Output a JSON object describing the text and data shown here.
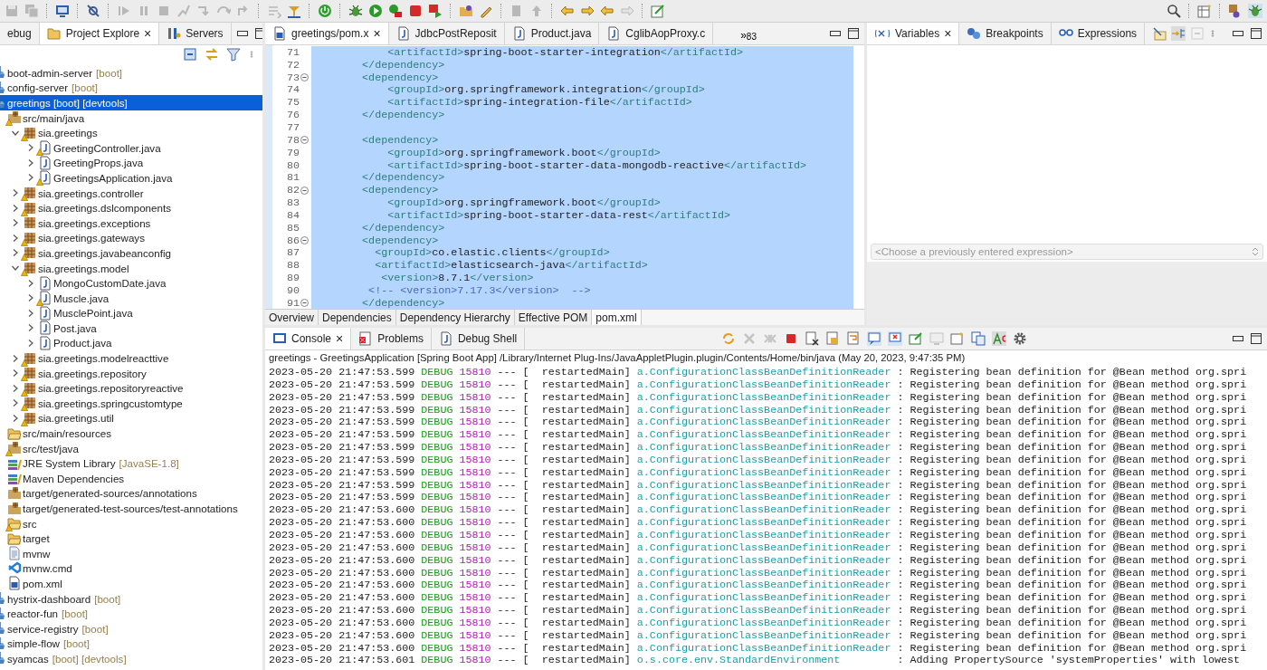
{
  "explorer": {
    "tabs": [
      {
        "label": "ebug",
        "selected": false
      },
      {
        "label": "Project Explore",
        "selected": true,
        "close": "×"
      },
      {
        "label": "Servers",
        "selected": false
      }
    ],
    "tree": [
      {
        "label": "boot-admin-server",
        "tag": "[boot]",
        "kind": "project",
        "selected": false
      },
      {
        "label": "config-server",
        "tag": "[boot]",
        "kind": "project",
        "selected": false
      },
      {
        "label": "greetings [boot] [devtools]",
        "kind": "project",
        "selected": true,
        "children": [
          {
            "label": "src/main/java",
            "kind": "source",
            "selected": false,
            "warning": true,
            "children": [
              {
                "label": "sia.greetings",
                "kind": "package",
                "selected": false,
                "warning": true,
                "expanded": true,
                "children": [
                  {
                    "label": "GreetingController.java",
                    "kind": "java",
                    "selected": false,
                    "warning": true,
                    "expanded": false
                  },
                  {
                    "label": "GreetingProps.java",
                    "kind": "java",
                    "selected": false,
                    "expanded": false
                  },
                  {
                    "label": "GreetingsApplication.java",
                    "kind": "java",
                    "selected": false,
                    "warning": true,
                    "expanded": false
                  }
                ]
              },
              {
                "label": "sia.greetings.controller",
                "kind": "package",
                "selected": false,
                "warning": true,
                "expanded": false
              },
              {
                "label": "sia.greetings.dslcomponents",
                "kind": "package",
                "selected": false,
                "warning": true,
                "expanded": false
              },
              {
                "label": "sia.greetings.exceptions",
                "kind": "package",
                "selected": false,
                "expanded": false
              },
              {
                "label": "sia.greetings.gateways",
                "kind": "package",
                "selected": false,
                "warning": true,
                "expanded": false
              },
              {
                "label": "sia.greetings.javabeanconfig",
                "kind": "package",
                "selected": false,
                "warning": true,
                "expanded": false
              },
              {
                "label": "sia.greetings.model",
                "kind": "package",
                "selected": false,
                "warning": true,
                "expanded": true,
                "children": [
                  {
                    "label": "MongoCustomDate.java",
                    "kind": "java",
                    "selected": false,
                    "expanded": false
                  },
                  {
                    "label": "Muscle.java",
                    "kind": "java",
                    "selected": false,
                    "warning": true,
                    "expanded": false
                  },
                  {
                    "label": "MusclePoint.java",
                    "kind": "java",
                    "selected": false,
                    "expanded": false
                  },
                  {
                    "label": "Post.java",
                    "kind": "java",
                    "selected": false,
                    "expanded": false
                  },
                  {
                    "label": "Product.java",
                    "kind": "java",
                    "selected": false,
                    "expanded": false
                  }
                ]
              },
              {
                "label": "sia.greetings.modelreacttive",
                "kind": "package",
                "selected": false,
                "warning": true,
                "expanded": false
              },
              {
                "label": "sia.greetings.repository",
                "kind": "package",
                "selected": false,
                "warning": true,
                "expanded": false
              },
              {
                "label": "sia.greetings.repositoryreactive",
                "kind": "package",
                "selected": false,
                "warning": true,
                "expanded": false
              },
              {
                "label": "sia.greetings.springcustomtype",
                "kind": "package",
                "selected": false,
                "warning": true,
                "expanded": false
              },
              {
                "label": "sia.greetings.util",
                "kind": "package",
                "selected": false,
                "warning": true,
                "expanded": false
              }
            ]
          },
          {
            "label": "src/main/resources",
            "kind": "folder",
            "selected": false
          },
          {
            "label": "src/test/java",
            "kind": "source",
            "selected": false,
            "warning": true
          },
          {
            "label": "JRE System Library",
            "tag": "[JavaSE-1.8]",
            "kind": "library",
            "selected": false
          },
          {
            "label": "Maven Dependencies",
            "kind": "library",
            "selected": false
          },
          {
            "label": "target/generated-sources/annotations",
            "kind": "source",
            "selected": false
          },
          {
            "label": "target/generated-test-sources/test-annotations",
            "kind": "source",
            "selected": false
          },
          {
            "label": "src",
            "kind": "folder",
            "selected": false,
            "warning": true
          },
          {
            "label": "target",
            "kind": "folder",
            "selected": false
          },
          {
            "label": "mvnw",
            "kind": "text",
            "selected": false
          },
          {
            "label": "mvnw.cmd",
            "kind": "script",
            "selected": false
          },
          {
            "label": "pom.xml",
            "kind": "maven",
            "selected": false
          }
        ]
      },
      {
        "label": "hystrix-dashboard",
        "tag": "[boot]",
        "kind": "project",
        "selected": false
      },
      {
        "label": "reactor-fun",
        "tag": "[boot]",
        "kind": "project",
        "selected": false
      },
      {
        "label": "service-registry",
        "tag": "[boot]",
        "kind": "project",
        "selected": false
      },
      {
        "label": "simple-flow",
        "tag": "[boot]",
        "kind": "project",
        "selected": false
      },
      {
        "label": "syamcas",
        "tag": "[boot] [devtools]",
        "kind": "project",
        "selected": false
      }
    ]
  },
  "editor": {
    "tabs": [
      {
        "label": "greetings/pom.x",
        "kind": "maven",
        "selected": true,
        "close": "×"
      },
      {
        "label": "JdbcPostReposit",
        "kind": "java",
        "selected": false
      },
      {
        "label": "Product.java",
        "kind": "java",
        "selected": false
      },
      {
        "label": "CglibAopProxy.c",
        "kind": "class",
        "selected": false
      }
    ],
    "overflow": {
      "chevron": "»",
      "count": "83"
    },
    "lines": [
      {
        "num": "71",
        "kind": "xml",
        "selected": true,
        "code": "            <artifactId>spring-boot-starter-integration</artifactId>"
      },
      {
        "num": "72",
        "kind": "xml",
        "selected": true,
        "code": "        </dependency>"
      },
      {
        "num": "73",
        "fold": true,
        "kind": "xml",
        "selected": true,
        "code": "        <dependency>"
      },
      {
        "num": "74",
        "kind": "xml",
        "selected": true,
        "code": "            <groupId>org.springframework.integration</groupId>"
      },
      {
        "num": "75",
        "kind": "xml",
        "selected": true,
        "code": "            <artifactId>spring-integration-file</artifactId>"
      },
      {
        "num": "76",
        "kind": "xml",
        "selected": true,
        "code": "        </dependency>"
      },
      {
        "num": "77",
        "selected": true
      },
      {
        "num": "78",
        "fold": true,
        "kind": "xml",
        "selected": true,
        "code": "        <dependency>"
      },
      {
        "num": "79",
        "kind": "xml",
        "selected": true,
        "code": "            <groupId>org.springframework.boot</groupId>"
      },
      {
        "num": "80",
        "kind": "xml",
        "selected": true,
        "code": "            <artifactId>spring-boot-starter-data-mongodb-reactive</artifactId>"
      },
      {
        "num": "81",
        "kind": "xml",
        "selected": true,
        "code": "        </dependency>"
      },
      {
        "num": "82",
        "fold": true,
        "kind": "xml",
        "selected": true,
        "code": "        <dependency>"
      },
      {
        "num": "83",
        "kind": "xml",
        "selected": true,
        "code": "            <groupId>org.springframework.boot</groupId>"
      },
      {
        "num": "84",
        "kind": "xml",
        "selected": true,
        "code": "            <artifactId>spring-boot-starter-data-rest</artifactId>"
      },
      {
        "num": "85",
        "kind": "xml",
        "selected": true,
        "code": "        </dependency>"
      },
      {
        "num": "86",
        "fold": true,
        "kind": "xml",
        "selected": true,
        "code": "        <dependency>"
      },
      {
        "num": "87",
        "kind": "xml",
        "selected": true,
        "code": "          <groupId>co.elastic.clients</groupId>"
      },
      {
        "num": "88",
        "kind": "xml",
        "selected": true,
        "code": "          <artifactId>elasticsearch-java</artifactId>"
      },
      {
        "num": "89",
        "kind": "xml",
        "selected": true,
        "code": "           <version>8.7.1</version>"
      },
      {
        "num": "90",
        "kind": "comment",
        "selected": true,
        "code": "         <!-- <version>7.17.3</version>  -->"
      },
      {
        "num": "91",
        "fold": true,
        "kind": "xml",
        "selected": true,
        "code": "        </dependency>"
      }
    ],
    "bottom_tabs": [
      {
        "label": "Overview",
        "selected": false
      },
      {
        "label": "Dependencies",
        "selected": false
      },
      {
        "label": "Dependency Hierarchy",
        "selected": false
      },
      {
        "label": "Effective POM",
        "selected": false
      },
      {
        "label": "pom.xml",
        "selected": true
      }
    ]
  },
  "variables": {
    "tabs": [
      {
        "label": "Variables",
        "kind": "variables",
        "selected": true,
        "close": "×"
      },
      {
        "label": "Breakpoints",
        "kind": "breakpoints",
        "selected": false
      },
      {
        "label": "Expressions",
        "kind": "expressions",
        "selected": false
      }
    ],
    "expression_field": {
      "placeholder": "<Choose a previously entered expression>",
      "disabled": true
    }
  },
  "console": {
    "tabs": [
      {
        "label": "Console",
        "kind": "console",
        "selected": true,
        "close": "×"
      },
      {
        "label": "Problems",
        "kind": "problems",
        "selected": false
      },
      {
        "label": "Debug Shell",
        "kind": "shell",
        "selected": false
      }
    ],
    "description": "greetings - GreetingsApplication [Spring Boot App] /Library/Internet Plug-Ins/JavaAppletPlugin.plugin/Contents/Home/bin/java  (May 20, 2023, 9:47:35 PM)",
    "lines": [
      {
        "ts": "2023-05-20 21:47:53.599",
        "level": "DEBUG",
        "pid": "15810",
        "sep": "---",
        "thread": "[  restartedMain]",
        "logger": "a.ConfigurationClassBeanDefinitionReader",
        "msg": ": Registering bean definition for @Bean method org.spri"
      },
      {
        "ts": "2023-05-20 21:47:53.599",
        "level": "DEBUG",
        "pid": "15810",
        "sep": "---",
        "thread": "[  restartedMain]",
        "logger": "a.ConfigurationClassBeanDefinitionReader",
        "msg": ": Registering bean definition for @Bean method org.spri"
      },
      {
        "ts": "2023-05-20 21:47:53.599",
        "level": "DEBUG",
        "pid": "15810",
        "sep": "---",
        "thread": "[  restartedMain]",
        "logger": "a.ConfigurationClassBeanDefinitionReader",
        "msg": ": Registering bean definition for @Bean method org.spri"
      },
      {
        "ts": "2023-05-20 21:47:53.599",
        "level": "DEBUG",
        "pid": "15810",
        "sep": "---",
        "thread": "[  restartedMain]",
        "logger": "a.ConfigurationClassBeanDefinitionReader",
        "msg": ": Registering bean definition for @Bean method org.spri"
      },
      {
        "ts": "2023-05-20 21:47:53.599",
        "level": "DEBUG",
        "pid": "15810",
        "sep": "---",
        "thread": "[  restartedMain]",
        "logger": "a.ConfigurationClassBeanDefinitionReader",
        "msg": ": Registering bean definition for @Bean method org.spri"
      },
      {
        "ts": "2023-05-20 21:47:53.599",
        "level": "DEBUG",
        "pid": "15810",
        "sep": "---",
        "thread": "[  restartedMain]",
        "logger": "a.ConfigurationClassBeanDefinitionReader",
        "msg": ": Registering bean definition for @Bean method org.spri"
      },
      {
        "ts": "2023-05-20 21:47:53.599",
        "level": "DEBUG",
        "pid": "15810",
        "sep": "---",
        "thread": "[  restartedMain]",
        "logger": "a.ConfigurationClassBeanDefinitionReader",
        "msg": ": Registering bean definition for @Bean method org.spri"
      },
      {
        "ts": "2023-05-20 21:47:53.599",
        "level": "DEBUG",
        "pid": "15810",
        "sep": "---",
        "thread": "[  restartedMain]",
        "logger": "a.ConfigurationClassBeanDefinitionReader",
        "msg": ": Registering bean definition for @Bean method org.spri"
      },
      {
        "ts": "2023-05-20 21:47:53.599",
        "level": "DEBUG",
        "pid": "15810",
        "sep": "---",
        "thread": "[  restartedMain]",
        "logger": "a.ConfigurationClassBeanDefinitionReader",
        "msg": ": Registering bean definition for @Bean method org.spri"
      },
      {
        "ts": "2023-05-20 21:47:53.599",
        "level": "DEBUG",
        "pid": "15810",
        "sep": "---",
        "thread": "[  restartedMain]",
        "logger": "a.ConfigurationClassBeanDefinitionReader",
        "msg": ": Registering bean definition for @Bean method org.spri"
      },
      {
        "ts": "2023-05-20 21:47:53.599",
        "level": "DEBUG",
        "pid": "15810",
        "sep": "---",
        "thread": "[  restartedMain]",
        "logger": "a.ConfigurationClassBeanDefinitionReader",
        "msg": ": Registering bean definition for @Bean method org.spri"
      },
      {
        "ts": "2023-05-20 21:47:53.600",
        "level": "DEBUG",
        "pid": "15810",
        "sep": "---",
        "thread": "[  restartedMain]",
        "logger": "a.ConfigurationClassBeanDefinitionReader",
        "msg": ": Registering bean definition for @Bean method org.spri"
      },
      {
        "ts": "2023-05-20 21:47:53.600",
        "level": "DEBUG",
        "pid": "15810",
        "sep": "---",
        "thread": "[  restartedMain]",
        "logger": "a.ConfigurationClassBeanDefinitionReader",
        "msg": ": Registering bean definition for @Bean method org.spri"
      },
      {
        "ts": "2023-05-20 21:47:53.600",
        "level": "DEBUG",
        "pid": "15810",
        "sep": "---",
        "thread": "[  restartedMain]",
        "logger": "a.ConfigurationClassBeanDefinitionReader",
        "msg": ": Registering bean definition for @Bean method org.spri"
      },
      {
        "ts": "2023-05-20 21:47:53.600",
        "level": "DEBUG",
        "pid": "15810",
        "sep": "---",
        "thread": "[  restartedMain]",
        "logger": "a.ConfigurationClassBeanDefinitionReader",
        "msg": ": Registering bean definition for @Bean method org.spri"
      },
      {
        "ts": "2023-05-20 21:47:53.600",
        "level": "DEBUG",
        "pid": "15810",
        "sep": "---",
        "thread": "[  restartedMain]",
        "logger": "a.ConfigurationClassBeanDefinitionReader",
        "msg": ": Registering bean definition for @Bean method org.spri"
      },
      {
        "ts": "2023-05-20 21:47:53.600",
        "level": "DEBUG",
        "pid": "15810",
        "sep": "---",
        "thread": "[  restartedMain]",
        "logger": "a.ConfigurationClassBeanDefinitionReader",
        "msg": ": Registering bean definition for @Bean method org.spri"
      },
      {
        "ts": "2023-05-20 21:47:53.600",
        "level": "DEBUG",
        "pid": "15810",
        "sep": "---",
        "thread": "[  restartedMain]",
        "logger": "a.ConfigurationClassBeanDefinitionReader",
        "msg": ": Registering bean definition for @Bean method org.spri"
      },
      {
        "ts": "2023-05-20 21:47:53.600",
        "level": "DEBUG",
        "pid": "15810",
        "sep": "---",
        "thread": "[  restartedMain]",
        "logger": "a.ConfigurationClassBeanDefinitionReader",
        "msg": ": Registering bean definition for @Bean method org.spri"
      },
      {
        "ts": "2023-05-20 21:47:53.600",
        "level": "DEBUG",
        "pid": "15810",
        "sep": "---",
        "thread": "[  restartedMain]",
        "logger": "a.ConfigurationClassBeanDefinitionReader",
        "msg": ": Registering bean definition for @Bean method org.spri"
      },
      {
        "ts": "2023-05-20 21:47:53.600",
        "level": "DEBUG",
        "pid": "15810",
        "sep": "---",
        "thread": "[  restartedMain]",
        "logger": "a.ConfigurationClassBeanDefinitionReader",
        "msg": ": Registering bean definition for @Bean method org.spri"
      },
      {
        "ts": "2023-05-20 21:47:53.600",
        "level": "DEBUG",
        "pid": "15810",
        "sep": "---",
        "thread": "[  restartedMain]",
        "logger": "a.ConfigurationClassBeanDefinitionReader",
        "msg": ": Registering bean definition for @Bean method org.spri"
      },
      {
        "ts": "2023-05-20 21:47:53.600",
        "level": "DEBUG",
        "pid": "15810",
        "sep": "---",
        "thread": "[  restartedMain]",
        "logger": "a.ConfigurationClassBeanDefinitionReader",
        "msg": ": Registering bean definition for @Bean method org.spri"
      },
      {
        "ts": "2023-05-20 21:47:53.601",
        "level": "DEBUG",
        "pid": "15810",
        "sep": "---",
        "thread": "[  restartedMain]",
        "logger": "o.s.core.env.StandardEnvironment",
        "msg": ": Adding PropertySource 'systemProperties' with lowest"
      }
    ]
  }
}
